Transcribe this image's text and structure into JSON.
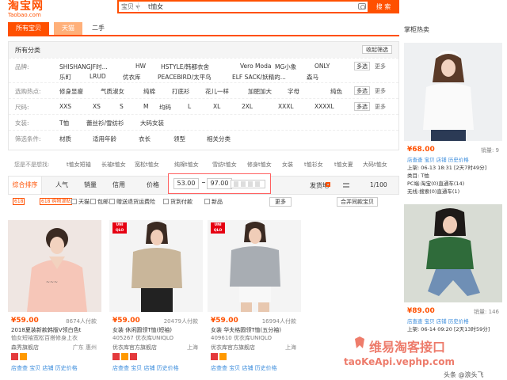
{
  "header": {
    "logo_cn": "淘宝网",
    "logo_en": "Taobao.com",
    "search_category": "宝贝",
    "search_query": "t恤女",
    "search_button": "搜 索"
  },
  "tabs": [
    "所有宝贝",
    "天猫",
    "二手"
  ],
  "side_title": "掌柜热卖",
  "filter_header": {
    "all": "所有分类",
    "collapse": "收起筛选"
  },
  "filters": [
    {
      "label": "品牌:",
      "items": [
        "SHISHANGJF时...",
        "HW",
        "HSTYLE/韩都衣舍",
        "Vero Moda",
        "MG小象",
        "ONLY",
        "乐町",
        "LRUD",
        "优衣库",
        "PEACEBIRD/太平鸟",
        "ELF SACK/妖精的...",
        "森马"
      ],
      "multi": "多选",
      "more": "更多"
    },
    {
      "label": "选购热点:",
      "items": [
        "修身显瘦",
        "气质淑女",
        "纯棉",
        "打底衫",
        "花儿一样",
        "加肥加大",
        "字母",
        "纯色"
      ],
      "multi": "多选",
      "more": "更多"
    },
    {
      "label": "尺码:",
      "items": [
        "XXS",
        "XS",
        "S",
        "M",
        "均码",
        "L",
        "XL",
        "2XL",
        "XXXL",
        "XXXXL"
      ],
      "multi": "多选",
      "more": "更多"
    },
    {
      "label": "女装:",
      "items": [
        "T恤",
        "蕾丝衫/雪纺衫",
        "大码女装"
      ],
      "multi": "",
      "more": ""
    },
    {
      "label": "筛选条件:",
      "items": [
        "材质",
        "适用年龄",
        "衣长",
        "领型",
        "相关分类"
      ],
      "multi": "",
      "more": ""
    }
  ],
  "guess": {
    "label": "您是不是想找:",
    "items": [
      "t恤女短袖",
      "长袖t恤女",
      "宽松t恤女",
      "纯棉t恤女",
      "雪纺t恤女",
      "修身t恤女",
      "女装",
      "t恤衫女",
      "t恤女夏",
      "大码t恤女"
    ]
  },
  "sort": {
    "items": [
      "综合排序",
      "人气",
      "销量",
      "信用",
      "价格"
    ],
    "price_min": "53.00",
    "price_max": "97.00",
    "location": "发货地",
    "page": "1/100"
  },
  "checks": {
    "items": [
      "天猫",
      "包邮",
      "赠送退货运费险",
      "货到付款",
      "新品"
    ],
    "badges": [
      "618",
      "618 购物津贴"
    ],
    "more": "更多",
    "merge": "合并同款宝贝"
  },
  "products": [
    {
      "price": "¥59.00",
      "sold": "8674人付款",
      "title1": "2018夏装新款韩版V领白色t",
      "title2": "恤女短袖宽松百搭修身上衣",
      "shop": "森秀旗舰店",
      "location": "广东 惠州",
      "links": "店查查 宝贝 店铺 历史价格"
    },
    {
      "price": "¥59.00",
      "sold": "20479人付款",
      "title1": "女装 休闲圆领T恤(短袖)",
      "title2": "405267 优衣库UNIQLO",
      "shop": "优衣库官方旗舰店",
      "location": "上海",
      "links": "店查查 宝贝 店铺 历史价格"
    },
    {
      "price": "¥59.00",
      "sold": "16994人付款",
      "title1": "女装 华夫格圆领T恤(五分袖)",
      "title2": "409610 优衣库UNIQLO",
      "shop": "优衣库官方旗舰店",
      "location": "上海",
      "links": "店查查 宝贝 店铺 历史价格"
    }
  ],
  "side_products": [
    {
      "price": "¥68.00",
      "sold": "销量: 9",
      "l1": "店查查 宝贝 店铺 历史价格",
      "l2": "上架: 06-13 18:31 [2天7时49分]",
      "l3": "类目: T恤",
      "l4": "PC端:淘宝(0)直通车(14)",
      "l5": "无线:搜索(0)直通车(1)"
    },
    {
      "price": "¥89.00",
      "sold": "销量: 146",
      "l1": "店查查 宝贝 店铺 历史价格",
      "l2": "上架: 06-14 09:20 [2天13时59分]",
      "l3": "",
      "l4": "",
      "l5": ""
    }
  ],
  "uniqlo": "UNI QLO",
  "watermark": {
    "line1": "维易淘客接口",
    "line2": "taoKeApi.vephp.com",
    "line3": "头条 @浪头飞"
  },
  "colors": {
    "accent": "#ff5000",
    "link": "#3c8ddc"
  }
}
